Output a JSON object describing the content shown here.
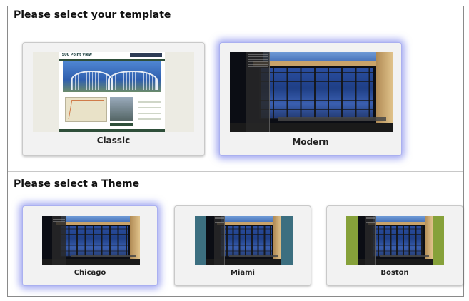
{
  "template_section": {
    "heading": "Please select your template",
    "options": [
      {
        "label": "Classic",
        "selected": false
      },
      {
        "label": "Modern",
        "selected": true
      }
    ]
  },
  "theme_section": {
    "heading": "Please select a Theme",
    "options": [
      {
        "label": "Chicago",
        "selected": true,
        "accent_color": "#1b1b1b"
      },
      {
        "label": "Miami",
        "selected": false,
        "accent_color": "#3c6f80"
      },
      {
        "label": "Boston",
        "selected": false,
        "accent_color": "#86a13a"
      }
    ]
  },
  "classic_preview": {
    "site_title": "500 Point View"
  },
  "colors": {
    "selection_glow": "#5a64e6",
    "card_background": "#f2f2f2"
  }
}
